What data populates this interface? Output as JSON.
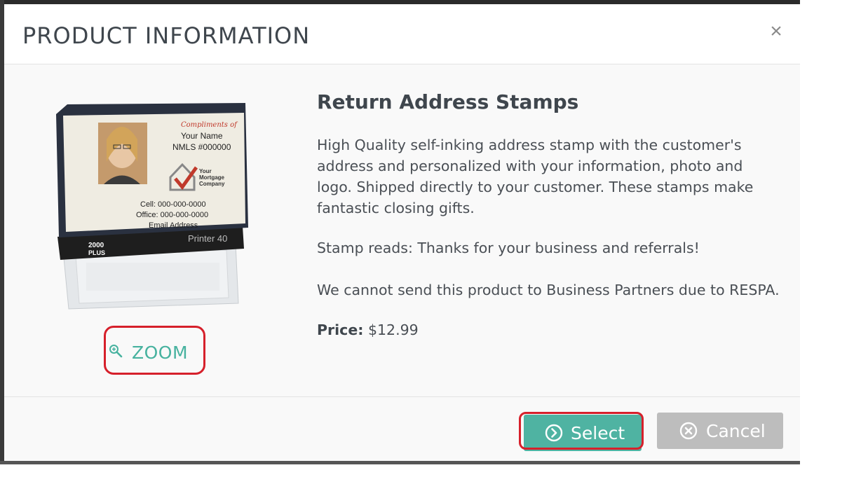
{
  "modal": {
    "title": "PRODUCT INFORMATION",
    "close_icon": "close-icon"
  },
  "product": {
    "image": {
      "stamp_text": {
        "compliments": "Compliments of",
        "name": "Your Name",
        "nmls": "NMLS #000000",
        "company_line1": "Your",
        "company_line2": "Mortgage",
        "company_line3": "Company",
        "cell": "Cell: 000-000-0000",
        "office": "Office: 000-000-0000",
        "email": "Email Address",
        "model": "Printer 40",
        "brand_line1": "2000",
        "brand_line2": "PLUS"
      }
    },
    "zoom_label": "ZOOM",
    "name": "Return Address Stamps",
    "description_lines": [
      "High Quality self-inking address stamp with the customer's",
      "address and personalized with your information, photo and",
      "logo. Shipped directly to your customer. These stamps make",
      "fantastic closing gifts."
    ],
    "stamp_reads": "Stamp reads: Thanks for your business and referrals!",
    "respa_note": "We cannot send this product to Business Partners due to RESPA.",
    "price_label": "Price:",
    "price_value": "$12.99"
  },
  "footer": {
    "select_label": "Select",
    "cancel_label": "Cancel"
  },
  "colors": {
    "accent": "#4fb3a2",
    "cancel": "#bdbdbd",
    "highlight": "#d6202b"
  }
}
